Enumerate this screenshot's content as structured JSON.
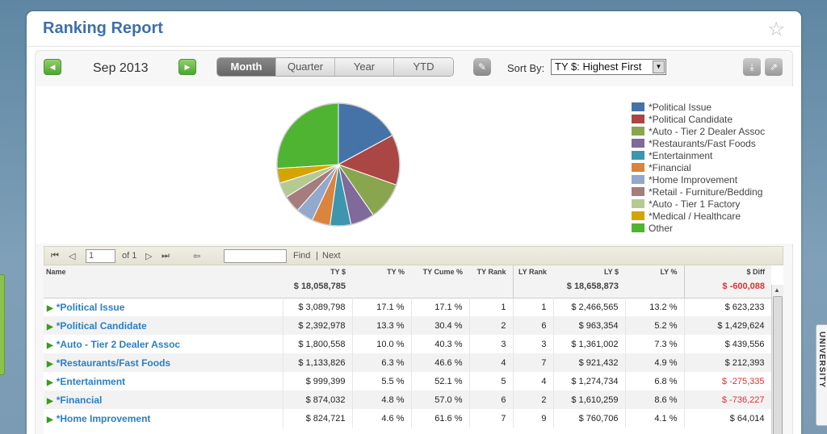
{
  "title": "Ranking Report",
  "period": {
    "label": "Sep 2013",
    "tabs": [
      "Month",
      "Quarter",
      "Year",
      "YTD"
    ],
    "active_tab": "Month"
  },
  "sort": {
    "label": "Sort By:",
    "value": "TY $: Highest First"
  },
  "side_tab": {
    "label": "UNIVERSITY"
  },
  "icons": {
    "prev": "prev-arrow-icon",
    "next": "next-arrow-icon",
    "edit": "pencil-icon",
    "download": "download-icon",
    "popout": "popout-icon",
    "star": "star-icon"
  },
  "chart_data": {
    "type": "pie",
    "labels": [
      "*Political Issue",
      "*Political Candidate",
      "*Auto - Tier 2 Dealer Assoc",
      "*Restaurants/Fast Foods",
      "*Entertainment",
      "*Financial",
      "*Home Improvement",
      "*Retail - Furniture/Bedding",
      "*Auto - Tier 1 Factory",
      "*Medical / Healthcare",
      "Other"
    ],
    "values": [
      17.1,
      13.3,
      10.0,
      6.3,
      5.5,
      4.8,
      4.6,
      4.5,
      4.0,
      3.9,
      26.0
    ],
    "colors": [
      "#4572a7",
      "#aa4643",
      "#89a54e",
      "#80699b",
      "#3d96ae",
      "#db843d",
      "#92a8cd",
      "#a47d7c",
      "#b5ca92",
      "#d4a500",
      "#4fb431"
    ],
    "legend_position": "right"
  },
  "pager": {
    "page": "1",
    "of": "of 1",
    "find": "Find",
    "sep": "|",
    "next": "Next"
  },
  "table": {
    "headers": [
      "Name",
      "TY $",
      "TY %",
      "TY Cume %",
      "TY Rank",
      "LY Rank",
      "LY $",
      "LY %",
      "$ Diff"
    ],
    "totals": {
      "ty": "$ 18,058,785",
      "ly": "$ 18,658,873",
      "diff": "$ -600,088"
    },
    "rows": [
      {
        "name": "*Political Issue",
        "ty": "$ 3,089,798",
        "typ": "17.1 %",
        "cume": "17.1 %",
        "tyrank": "1",
        "lyrank": "1",
        "ly": "$ 2,466,565",
        "lyp": "13.2 %",
        "diff": "$ 623,233",
        "neg": false
      },
      {
        "name": "*Political Candidate",
        "ty": "$ 2,392,978",
        "typ": "13.3 %",
        "cume": "30.4 %",
        "tyrank": "2",
        "lyrank": "6",
        "ly": "$ 963,354",
        "lyp": "5.2 %",
        "diff": "$ 1,429,624",
        "neg": false
      },
      {
        "name": "*Auto - Tier 2 Dealer Assoc",
        "ty": "$ 1,800,558",
        "typ": "10.0 %",
        "cume": "40.3 %",
        "tyrank": "3",
        "lyrank": "3",
        "ly": "$ 1,361,002",
        "lyp": "7.3 %",
        "diff": "$ 439,556",
        "neg": false
      },
      {
        "name": "*Restaurants/Fast Foods",
        "ty": "$ 1,133,826",
        "typ": "6.3 %",
        "cume": "46.6 %",
        "tyrank": "4",
        "lyrank": "7",
        "ly": "$ 921,432",
        "lyp": "4.9 %",
        "diff": "$ 212,393",
        "neg": false
      },
      {
        "name": "*Entertainment",
        "ty": "$ 999,399",
        "typ": "5.5 %",
        "cume": "52.1 %",
        "tyrank": "5",
        "lyrank": "4",
        "ly": "$ 1,274,734",
        "lyp": "6.8 %",
        "diff": "$ -275,335",
        "neg": true
      },
      {
        "name": "*Financial",
        "ty": "$ 874,032",
        "typ": "4.8 %",
        "cume": "57.0 %",
        "tyrank": "6",
        "lyrank": "2",
        "ly": "$ 1,610,259",
        "lyp": "8.6 %",
        "diff": "$ -736,227",
        "neg": true
      },
      {
        "name": "*Home Improvement",
        "ty": "$ 824,721",
        "typ": "4.6 %",
        "cume": "61.6 %",
        "tyrank": "7",
        "lyrank": "9",
        "ly": "$ 760,706",
        "lyp": "4.1 %",
        "diff": "$ 64,014",
        "neg": false
      }
    ]
  }
}
